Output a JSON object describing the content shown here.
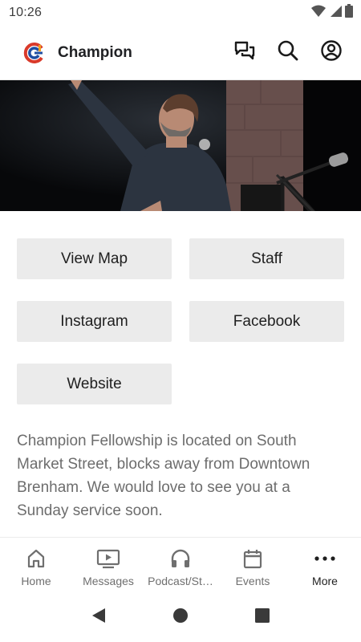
{
  "status_bar": {
    "time": "10:26",
    "icons": [
      "wifi-icon",
      "cellular-signal-icon",
      "battery-icon"
    ]
  },
  "app_bar": {
    "title": "Champion",
    "logo_icon": "champion-logo",
    "actions": [
      "chat-icon",
      "search-icon",
      "account-icon"
    ]
  },
  "hero": {
    "image": "speaker-on-stage-photo"
  },
  "links": {
    "view_map": "View Map",
    "staff": "Staff",
    "instagram": "Instagram",
    "facebook": "Facebook",
    "website": "Website"
  },
  "description": "Champion Fellowship is located on South Market Street, blocks away from Downtown Brenham. We would love to see you at a Sunday service soon.",
  "bottom_nav": {
    "home": "Home",
    "messages": "Messages",
    "podcast": "Podcast/St…",
    "events": "Events",
    "more": "More",
    "active": "More"
  },
  "colors": {
    "button_bg": "#ebebeb",
    "text_muted": "#6d6d6d",
    "logo_red": "#d93a2b",
    "logo_blue": "#1f4fa3",
    "logo_orange": "#f0a020"
  }
}
